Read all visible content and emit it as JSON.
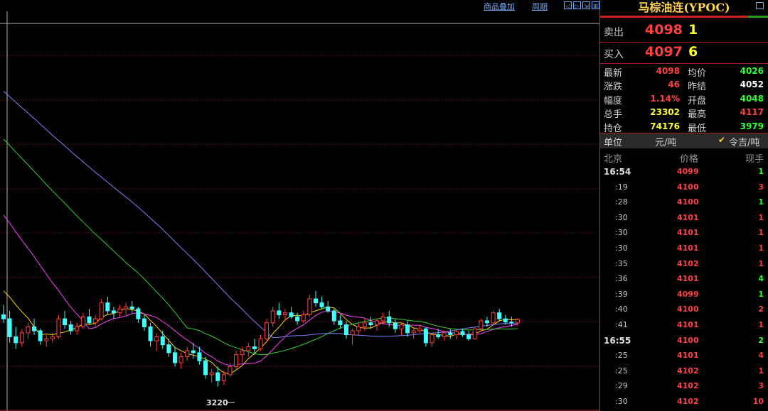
{
  "toolbar": {
    "overlay_label": "商品叠加",
    "cycle_label": "周期",
    "nav_buttons": [
      "◁",
      "▷",
      "⇲",
      "⊞"
    ]
  },
  "colors": {
    "up": "#ff4040",
    "down": "#40ffff",
    "equal": "#ffffff",
    "gridline": "#8a1a1a",
    "ma1": "#ffd700",
    "ma2": "#ff40ff",
    "ma3": "#30d030",
    "ma4": "#8080ff"
  },
  "chart_data": {
    "type": "candlestick",
    "low_annotation": "3220",
    "grid": true,
    "candles": [
      {
        "o": 4080,
        "h": 4105,
        "l": 4060,
        "c": 4070
      },
      {
        "o": 4070,
        "h": 4090,
        "l": 4010,
        "c": 4025
      },
      {
        "o": 4025,
        "h": 4050,
        "l": 3995,
        "c": 4010
      },
      {
        "o": 4010,
        "h": 4045,
        "l": 4000,
        "c": 4035
      },
      {
        "o": 4035,
        "h": 4060,
        "l": 4020,
        "c": 4050
      },
      {
        "o": 4050,
        "h": 4070,
        "l": 4030,
        "c": 4040
      },
      {
        "o": 4040,
        "h": 4045,
        "l": 4005,
        "c": 4015
      },
      {
        "o": 4015,
        "h": 4030,
        "l": 4000,
        "c": 4020
      },
      {
        "o": 4020,
        "h": 4035,
        "l": 4010,
        "c": 4025
      },
      {
        "o": 4025,
        "h": 4080,
        "l": 4020,
        "c": 4070
      },
      {
        "o": 4070,
        "h": 4090,
        "l": 4045,
        "c": 4055
      },
      {
        "o": 4055,
        "h": 4065,
        "l": 4030,
        "c": 4040
      },
      {
        "o": 4040,
        "h": 4060,
        "l": 4030,
        "c": 4050
      },
      {
        "o": 4050,
        "h": 4085,
        "l": 4045,
        "c": 4075
      },
      {
        "o": 4075,
        "h": 4095,
        "l": 4055,
        "c": 4060
      },
      {
        "o": 4060,
        "h": 4080,
        "l": 4050,
        "c": 4070
      },
      {
        "o": 4070,
        "h": 4120,
        "l": 4065,
        "c": 4110
      },
      {
        "o": 4110,
        "h": 4125,
        "l": 4080,
        "c": 4090
      },
      {
        "o": 4090,
        "h": 4100,
        "l": 4070,
        "c": 4085
      },
      {
        "o": 4085,
        "h": 4105,
        "l": 4075,
        "c": 4095
      },
      {
        "o": 4095,
        "h": 4110,
        "l": 4080,
        "c": 4100
      },
      {
        "o": 4100,
        "h": 4115,
        "l": 4085,
        "c": 4095
      },
      {
        "o": 4095,
        "h": 4100,
        "l": 4060,
        "c": 4070
      },
      {
        "o": 4070,
        "h": 4080,
        "l": 4040,
        "c": 4050
      },
      {
        "o": 4050,
        "h": 4060,
        "l": 4000,
        "c": 4015
      },
      {
        "o": 4015,
        "h": 4035,
        "l": 3990,
        "c": 4025
      },
      {
        "o": 4025,
        "h": 4040,
        "l": 3995,
        "c": 4005
      },
      {
        "o": 4005,
        "h": 4020,
        "l": 3975,
        "c": 3985
      },
      {
        "o": 3985,
        "h": 4000,
        "l": 3950,
        "c": 3960
      },
      {
        "o": 3960,
        "h": 3985,
        "l": 3945,
        "c": 3975
      },
      {
        "o": 3975,
        "h": 4000,
        "l": 3965,
        "c": 3990
      },
      {
        "o": 3990,
        "h": 4010,
        "l": 3970,
        "c": 3985
      },
      {
        "o": 3985,
        "h": 4000,
        "l": 3955,
        "c": 3965
      },
      {
        "o": 3965,
        "h": 3975,
        "l": 3920,
        "c": 3930
      },
      {
        "o": 3930,
        "h": 3945,
        "l": 3910,
        "c": 3935
      },
      {
        "o": 3935,
        "h": 3950,
        "l": 3900,
        "c": 3915
      },
      {
        "o": 3915,
        "h": 3940,
        "l": 3905,
        "c": 3930
      },
      {
        "o": 3930,
        "h": 3960,
        "l": 3925,
        "c": 3950
      },
      {
        "o": 3950,
        "h": 3990,
        "l": 3945,
        "c": 3980
      },
      {
        "o": 3980,
        "h": 4000,
        "l": 3960,
        "c": 3990
      },
      {
        "o": 3990,
        "h": 4010,
        "l": 3975,
        "c": 4000
      },
      {
        "o": 4000,
        "h": 4020,
        "l": 3980,
        "c": 3995
      },
      {
        "o": 3995,
        "h": 4030,
        "l": 3990,
        "c": 4020
      },
      {
        "o": 4020,
        "h": 4070,
        "l": 4010,
        "c": 4060
      },
      {
        "o": 4060,
        "h": 4100,
        "l": 4050,
        "c": 4090
      },
      {
        "o": 4090,
        "h": 4110,
        "l": 4070,
        "c": 4080
      },
      {
        "o": 4080,
        "h": 4095,
        "l": 4065,
        "c": 4085
      },
      {
        "o": 4085,
        "h": 4100,
        "l": 4070,
        "c": 4075
      },
      {
        "o": 4075,
        "h": 4085,
        "l": 4055,
        "c": 4065
      },
      {
        "o": 4065,
        "h": 4090,
        "l": 4060,
        "c": 4080
      },
      {
        "o": 4080,
        "h": 4130,
        "l": 4075,
        "c": 4120
      },
      {
        "o": 4120,
        "h": 4140,
        "l": 4100,
        "c": 4110
      },
      {
        "o": 4110,
        "h": 4125,
        "l": 4095,
        "c": 4100
      },
      {
        "o": 4100,
        "h": 4115,
        "l": 4085,
        "c": 4090
      },
      {
        "o": 4090,
        "h": 4095,
        "l": 4055,
        "c": 4065
      },
      {
        "o": 4065,
        "h": 4080,
        "l": 4045,
        "c": 4055
      },
      {
        "o": 4055,
        "h": 4065,
        "l": 4020,
        "c": 4030
      },
      {
        "o": 4030,
        "h": 4045,
        "l": 4005,
        "c": 4040
      },
      {
        "o": 4040,
        "h": 4060,
        "l": 4030,
        "c": 4050
      },
      {
        "o": 4050,
        "h": 4070,
        "l": 4040,
        "c": 4060
      },
      {
        "o": 4060,
        "h": 4075,
        "l": 4045,
        "c": 4055
      },
      {
        "o": 4055,
        "h": 4070,
        "l": 4040,
        "c": 4065
      },
      {
        "o": 4065,
        "h": 4085,
        "l": 4055,
        "c": 4075
      },
      {
        "o": 4075,
        "h": 4090,
        "l": 4050,
        "c": 4060
      },
      {
        "o": 4060,
        "h": 4070,
        "l": 4035,
        "c": 4045
      },
      {
        "o": 4045,
        "h": 4060,
        "l": 4030,
        "c": 4055
      },
      {
        "o": 4055,
        "h": 4065,
        "l": 4025,
        "c": 4035
      },
      {
        "o": 4035,
        "h": 4050,
        "l": 4020,
        "c": 4040
      },
      {
        "o": 4040,
        "h": 4055,
        "l": 4035,
        "c": 4045
      },
      {
        "o": 4045,
        "h": 4050,
        "l": 4000,
        "c": 4010
      },
      {
        "o": 4010,
        "h": 4035,
        "l": 4000,
        "c": 4030
      },
      {
        "o": 4030,
        "h": 4045,
        "l": 4020,
        "c": 4025
      },
      {
        "o": 4025,
        "h": 4040,
        "l": 4015,
        "c": 4035
      },
      {
        "o": 4035,
        "h": 4045,
        "l": 4020,
        "c": 4030
      },
      {
        "o": 4030,
        "h": 4042,
        "l": 4018,
        "c": 4038
      },
      {
        "o": 4038,
        "h": 4045,
        "l": 4025,
        "c": 4030
      },
      {
        "o": 4030,
        "h": 4040,
        "l": 4015,
        "c": 4020
      },
      {
        "o": 4020,
        "h": 4050,
        "l": 4018,
        "c": 4045
      },
      {
        "o": 4045,
        "h": 4070,
        "l": 4040,
        "c": 4065
      },
      {
        "o": 4065,
        "h": 4075,
        "l": 4050,
        "c": 4060
      },
      {
        "o": 4060,
        "h": 4090,
        "l": 4055,
        "c": 4085
      },
      {
        "o": 4085,
        "h": 4095,
        "l": 4065,
        "c": 4070
      },
      {
        "o": 4070,
        "h": 4080,
        "l": 4055,
        "c": 4062
      },
      {
        "o": 4062,
        "h": 4075,
        "l": 4050,
        "c": 4060
      },
      {
        "o": 4060,
        "h": 4072,
        "l": 4052,
        "c": 4068
      }
    ]
  },
  "panel": {
    "title": "马棕油连(YPOC)",
    "sell": {
      "label": "卖出",
      "price": "4098",
      "volume": "1"
    },
    "buy": {
      "label": "买入",
      "price": "4097",
      "volume": "6"
    },
    "stats": [
      {
        "l1": "最新",
        "v1": "4098",
        "c1": "#ff4040",
        "l2": "均价",
        "v2": "4026",
        "c2": "#30ff30"
      },
      {
        "l1": "涨跌",
        "v1": "46",
        "c1": "#ff4040",
        "l2": "昨结",
        "v2": "4052",
        "c2": "#ffffff"
      },
      {
        "l1": "幅度",
        "v1": "1.14%",
        "c1": "#ff4040",
        "l2": "开盘",
        "v2": "4048",
        "c2": "#30ff30"
      },
      {
        "l1": "总手",
        "v1": "23302",
        "c1": "#ffff30",
        "l2": "最高",
        "v2": "4117",
        "c2": "#ff4040"
      },
      {
        "l1": "持仓",
        "v1": "74176",
        "c1": "#ffff30",
        "l2": "最低",
        "v2": "3979",
        "c2": "#30ff30"
      }
    ],
    "unit": {
      "label": "单位",
      "value": "元/吨",
      "check": "✔",
      "alt": "令吉/吨"
    },
    "tick_header": {
      "time": "北京",
      "price": "价格",
      "volume": "现手"
    },
    "ticks": [
      {
        "time": "16:54",
        "full": true,
        "price": "4099",
        "vol": "1",
        "vc": "#30ff30"
      },
      {
        "time": ":19",
        "full": false,
        "price": "4100",
        "vol": "3",
        "vc": "#ff4040"
      },
      {
        "time": ":28",
        "full": false,
        "price": "4100",
        "vol": "1",
        "vc": "#30ff30"
      },
      {
        "time": ":30",
        "full": false,
        "price": "4101",
        "vol": "1",
        "vc": "#ff4040"
      },
      {
        "time": ":30",
        "full": false,
        "price": "4101",
        "vol": "1",
        "vc": "#ff4040"
      },
      {
        "time": ":30",
        "full": false,
        "price": "4101",
        "vol": "1",
        "vc": "#ff4040"
      },
      {
        "time": ":35",
        "full": false,
        "price": "4102",
        "vol": "1",
        "vc": "#ff4040"
      },
      {
        "time": ":36",
        "full": false,
        "price": "4101",
        "vol": "4",
        "vc": "#30ff30"
      },
      {
        "time": ":39",
        "full": false,
        "price": "4099",
        "vol": "1",
        "vc": "#30ff30"
      },
      {
        "time": ":40",
        "full": false,
        "price": "4100",
        "vol": "2",
        "vc": "#ff4040"
      },
      {
        "time": ":41",
        "full": false,
        "price": "4101",
        "vol": "1",
        "vc": "#ff4040"
      },
      {
        "time": "16:55",
        "full": true,
        "price": "4100",
        "vol": "2",
        "vc": "#30ff30"
      },
      {
        "time": ":25",
        "full": false,
        "price": "4101",
        "vol": "4",
        "vc": "#ff4040"
      },
      {
        "time": ":25",
        "full": false,
        "price": "4102",
        "vol": "1",
        "vc": "#ff4040"
      },
      {
        "time": ":29",
        "full": false,
        "price": "4102",
        "vol": "3",
        "vc": "#ff4040"
      },
      {
        "time": ":30",
        "full": false,
        "price": "4102",
        "vol": "10",
        "vc": "#ff4040"
      }
    ]
  }
}
